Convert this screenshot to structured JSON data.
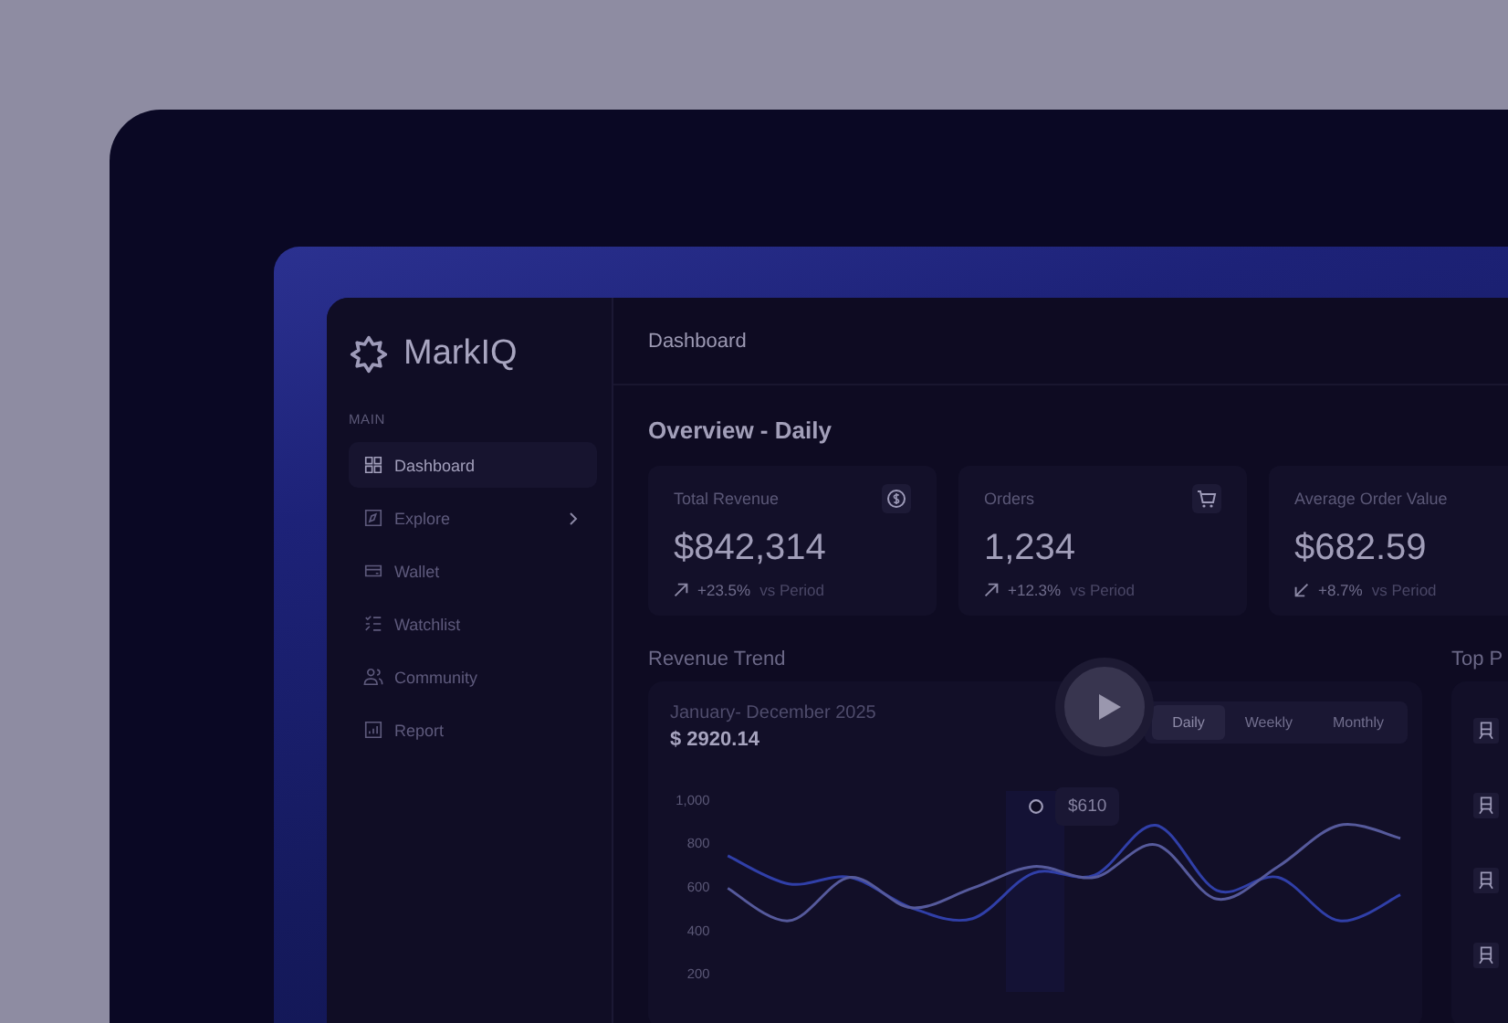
{
  "app": {
    "logo": "MarkIQ"
  },
  "sidebar": {
    "section": "MAIN",
    "items": [
      {
        "label": "Dashboard",
        "selected": true,
        "has_submenu": false
      },
      {
        "label": "Explore",
        "selected": false,
        "has_submenu": true
      },
      {
        "label": "Wallet",
        "selected": false,
        "has_submenu": false
      },
      {
        "label": "Watchlist",
        "selected": false,
        "has_submenu": false
      },
      {
        "label": "Community",
        "selected": false,
        "has_submenu": false
      },
      {
        "label": "Report",
        "selected": false,
        "has_submenu": false
      }
    ]
  },
  "header": {
    "title": "Dashboard"
  },
  "overview": {
    "title": "Overview - Daily",
    "cards": [
      {
        "label": "Total Revenue",
        "value": "$842,314",
        "change": "+23.5%",
        "kind": "up",
        "note": "vs Period"
      },
      {
        "label": "Orders",
        "value": "1,234",
        "change": "+12.3%",
        "kind": "up",
        "note": "vs Period"
      },
      {
        "label": "Average Order Value",
        "value": "$682.59",
        "change": "+8.7%",
        "kind": "down",
        "note": "vs Period"
      }
    ]
  },
  "revenue_trend": {
    "title": "Revenue Trend",
    "period": "January- December 2025",
    "amount": "$ 2920.14",
    "tabs": [
      {
        "label": "Daily",
        "selected": true
      },
      {
        "label": "Weekly",
        "selected": false
      },
      {
        "label": "Monthly",
        "selected": false
      }
    ],
    "tooltip": "$610",
    "chart_data": {
      "type": "line",
      "ylim": [
        200,
        1000
      ],
      "yticks": [
        {
          "value": 1000,
          "label": "1,000"
        },
        800,
        600,
        400,
        200
      ],
      "series": [
        {
          "color": "#303fa8",
          "values": [
            740,
            610,
            640,
            500,
            450,
            660,
            650,
            880,
            580,
            640,
            440,
            560
          ]
        },
        {
          "color": "#565a9c",
          "values": [
            590,
            440,
            640,
            500,
            590,
            690,
            640,
            790,
            540,
            690,
            880,
            820
          ]
        }
      ]
    }
  },
  "top_panel": {
    "title": "Top P"
  }
}
